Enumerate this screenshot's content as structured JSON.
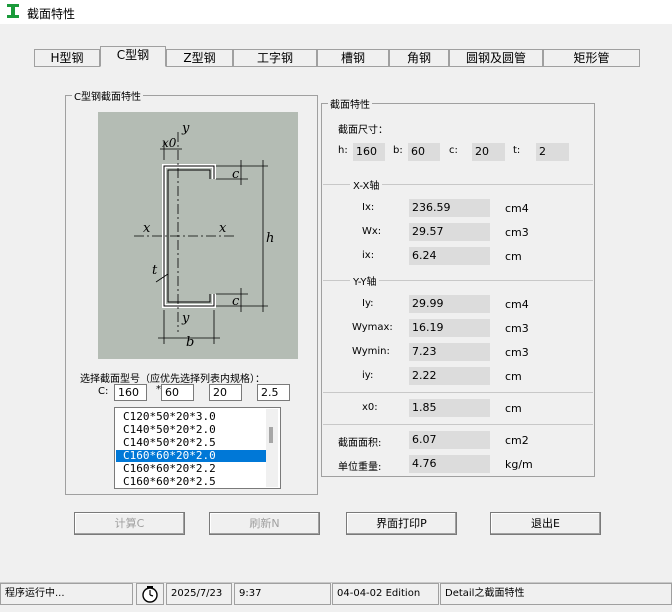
{
  "window": {
    "title": "截面特性"
  },
  "tabs": [
    "H型钢",
    "C型钢",
    "Z型钢",
    "工字钢",
    "槽钢",
    "角钢",
    "圆钢及圆管",
    "矩形管"
  ],
  "left_group": {
    "title": "C型钢截面特性"
  },
  "diagram": {
    "x0": "x0",
    "y_top": "y",
    "y_bottom": "y",
    "x_left": "x",
    "x_right": "x",
    "c_top": "c",
    "c_bottom": "c",
    "h": "h",
    "t": "t",
    "b": "b"
  },
  "select": {
    "prompt": "选择截面型号（应优先选择列表内规格）：",
    "c_label": "C:",
    "star": "*",
    "h": "160",
    "b": "60",
    "c": "20",
    "t": "2.5",
    "list": [
      "C120*50*20*3.0",
      "C140*50*20*2.0",
      "C140*50*20*2.5",
      "C160*60*20*2.0",
      "C160*60*20*2.2",
      "C160*60*20*2.5"
    ],
    "selected_index": 3
  },
  "props": {
    "title": "截面特性",
    "dims_title": "截面尺寸：",
    "h_label": "h:",
    "h": "160",
    "b_label": "b:",
    "b": "60",
    "c_label": "c:",
    "c": "20",
    "t_label": "t:",
    "t": "2",
    "xx_title": "X-X轴",
    "ix_label": "Ix:",
    "ix": "236.59",
    "ix_unit": "cm4",
    "wx_label": "Wx:",
    "wx": "29.57",
    "wx_unit": "cm3",
    "rx_label": "ix:",
    "rx": "6.24",
    "rx_unit": "cm",
    "yy_title": "Y-Y轴",
    "iy_label": "Iy:",
    "iy": "29.99",
    "iy_unit": "cm4",
    "wymax_label": "Wymax:",
    "wymax": "16.19",
    "wymax_unit": "cm3",
    "wymin_label": "Wymin:",
    "wymin": "7.23",
    "wymin_unit": "cm3",
    "ry_label": "iy:",
    "ry": "2.22",
    "ry_unit": "cm",
    "x0_label": "x0:",
    "x0": "1.85",
    "x0_unit": "cm",
    "area_label": "截面面积:",
    "area": "6.07",
    "area_unit": "cm2",
    "weight_label": "单位重量:",
    "weight": "4.76",
    "weight_unit": "kg/m"
  },
  "buttons": {
    "calc": "计算C",
    "refresh": "刷新N",
    "print": "界面打印P",
    "exit": "退出E"
  },
  "status": {
    "state": "程序运行中...",
    "date": "2025/7/23",
    "time": "9:37",
    "edition": "04-04-02 Edition",
    "detail": "Detail之截面特性"
  }
}
